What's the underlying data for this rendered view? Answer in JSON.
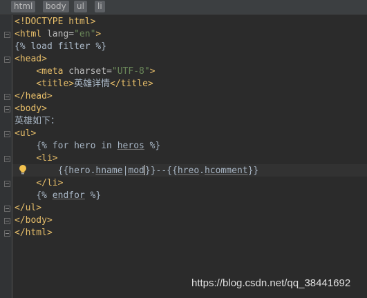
{
  "breadcrumb": [
    "html",
    "body",
    "ul",
    "li"
  ],
  "code": {
    "doctype": "<!DOCTYPE html>",
    "html_open": "<html ",
    "lang_attr": "lang=",
    "lang_val": "\"en\"",
    "html_close_bracket": ">",
    "load_filter": "{% load filter %}",
    "head_open": "<head>",
    "meta_open": "<meta ",
    "charset_attr": "charset=",
    "charset_val": "\"UTF-8\"",
    "meta_close": ">",
    "title_open": "<title>",
    "title_text": "英雄详情",
    "title_close": "</title>",
    "head_close": "</head>",
    "body_open": "<body>",
    "heroes_text": "英雄如下：",
    "ul_open": "<ul>",
    "for_start": "{% for hero in ",
    "for_var": "heros",
    "for_end": " %}",
    "li_open": "<li>",
    "expr_open": "{{hero.",
    "expr_field": "hname",
    "expr_pipe": "|",
    "expr_filter_a": "mod",
    "expr_filter_b": "",
    "expr_close": "}}--{{",
    "expr2_obj": "hreo",
    "expr2_dot": ".",
    "expr2_field": "hcomment",
    "expr2_close": "}}",
    "li_close": "</li>",
    "endfor_a": "{% ",
    "endfor_kw": "endfor",
    "endfor_b": " %}",
    "ul_close": "</ul>",
    "body_close": "</body>",
    "html_close": "</html>"
  },
  "watermark": "https://blog.csdn.net/qq_38441692",
  "icons": {
    "intention": "lightbulb-icon",
    "fold": "fold-marker-icon"
  },
  "colors": {
    "background": "#2b2b2b",
    "tag": "#e8bf6a",
    "string": "#6a8759",
    "text": "#a9b7c6"
  }
}
